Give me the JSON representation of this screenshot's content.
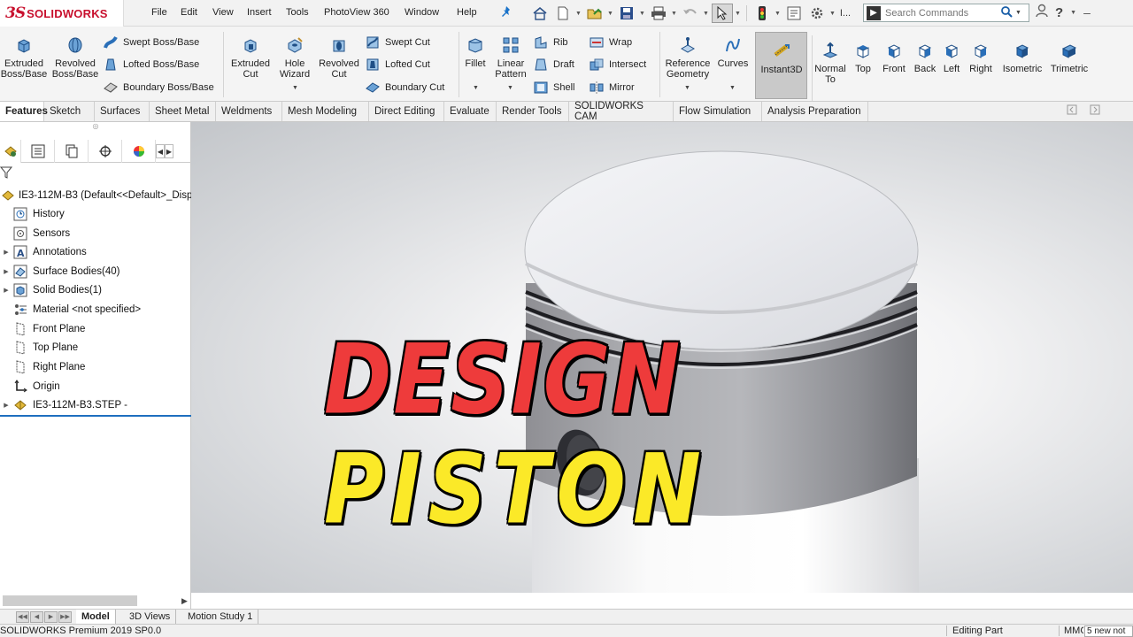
{
  "app": {
    "logo_mark": "3S",
    "logo_text": "SOLIDWORKS"
  },
  "menu": [
    "File",
    "Edit",
    "View",
    "Insert",
    "Tools",
    "PhotoView 360",
    "Window",
    "Help"
  ],
  "quick_access": {
    "icons": [
      "home-icon",
      "new-document-icon",
      "open-icon",
      "save-icon",
      "print-icon",
      "undo-icon",
      "select-icon",
      "traffic-light-icon",
      "file-properties-icon",
      "options-gear-icon"
    ],
    "more_label": "I..."
  },
  "search": {
    "placeholder": "Search Commands"
  },
  "account_icons": [
    "user-icon",
    "help-icon",
    "minimize-icon"
  ],
  "ribbon": {
    "extruded_boss": "Extruded Boss/Base",
    "revolved_boss": "Revolved Boss/Base",
    "swept_boss": "Swept Boss/Base",
    "lofted_boss": "Lofted Boss/Base",
    "boundary_boss": "Boundary Boss/Base",
    "extruded_cut": "Extruded Cut",
    "hole_wizard": "Hole Wizard",
    "revolved_cut": "Revolved Cut",
    "swept_cut": "Swept Cut",
    "lofted_cut": "Lofted Cut",
    "boundary_cut": "Boundary Cut",
    "fillet": "Fillet",
    "linear_pattern": "Linear Pattern",
    "rib": "Rib",
    "draft": "Draft",
    "shell": "Shell",
    "wrap": "Wrap",
    "intersect": "Intersect",
    "mirror": "Mirror",
    "reference_geometry": "Reference Geometry",
    "curves": "Curves",
    "instant3d": "Instant3D",
    "normal_to": "Normal To",
    "top": "Top",
    "front": "Front",
    "back": "Back",
    "left": "Left",
    "right": "Right",
    "isometric": "Isometric",
    "trimetric": "Trimetric"
  },
  "tabs": [
    "Features",
    "Sketch",
    "Surfaces",
    "Sheet Metal",
    "Weldments",
    "Mesh Modeling",
    "Direct Editing",
    "Evaluate",
    "Render Tools",
    "SOLIDWORKS CAM",
    "Flow Simulation",
    "Analysis Preparation"
  ],
  "tree": {
    "root": "IE3-112M-B3  (Default<<Default>_Disp",
    "items": [
      {
        "label": "History",
        "icon": "history-icon"
      },
      {
        "label": "Sensors",
        "icon": "sensors-icon"
      },
      {
        "label": "Annotations",
        "icon": "annotations-icon"
      },
      {
        "label": "Surface Bodies(40)",
        "icon": "surface-bodies-icon"
      },
      {
        "label": "Solid Bodies(1)",
        "icon": "solid-bodies-icon"
      },
      {
        "label": "Material <not specified>",
        "icon": "material-icon"
      },
      {
        "label": "Front Plane",
        "icon": "plane-icon"
      },
      {
        "label": "Top Plane",
        "icon": "plane-icon"
      },
      {
        "label": "Right Plane",
        "icon": "plane-icon"
      },
      {
        "label": "Origin",
        "icon": "origin-icon"
      },
      {
        "label": "IE3-112M-B3.STEP -",
        "icon": "imported-part-icon"
      }
    ]
  },
  "overlay": {
    "line1": "DESIGN",
    "line2": "PISTON"
  },
  "bottom_tabs": [
    "Model",
    "3D Views",
    "Motion Study 1"
  ],
  "status": {
    "left": "SOLIDWORKS Premium 2019 SP0.0",
    "mode": "Editing Part",
    "units": "MMGS",
    "notifications": "5 new not"
  }
}
